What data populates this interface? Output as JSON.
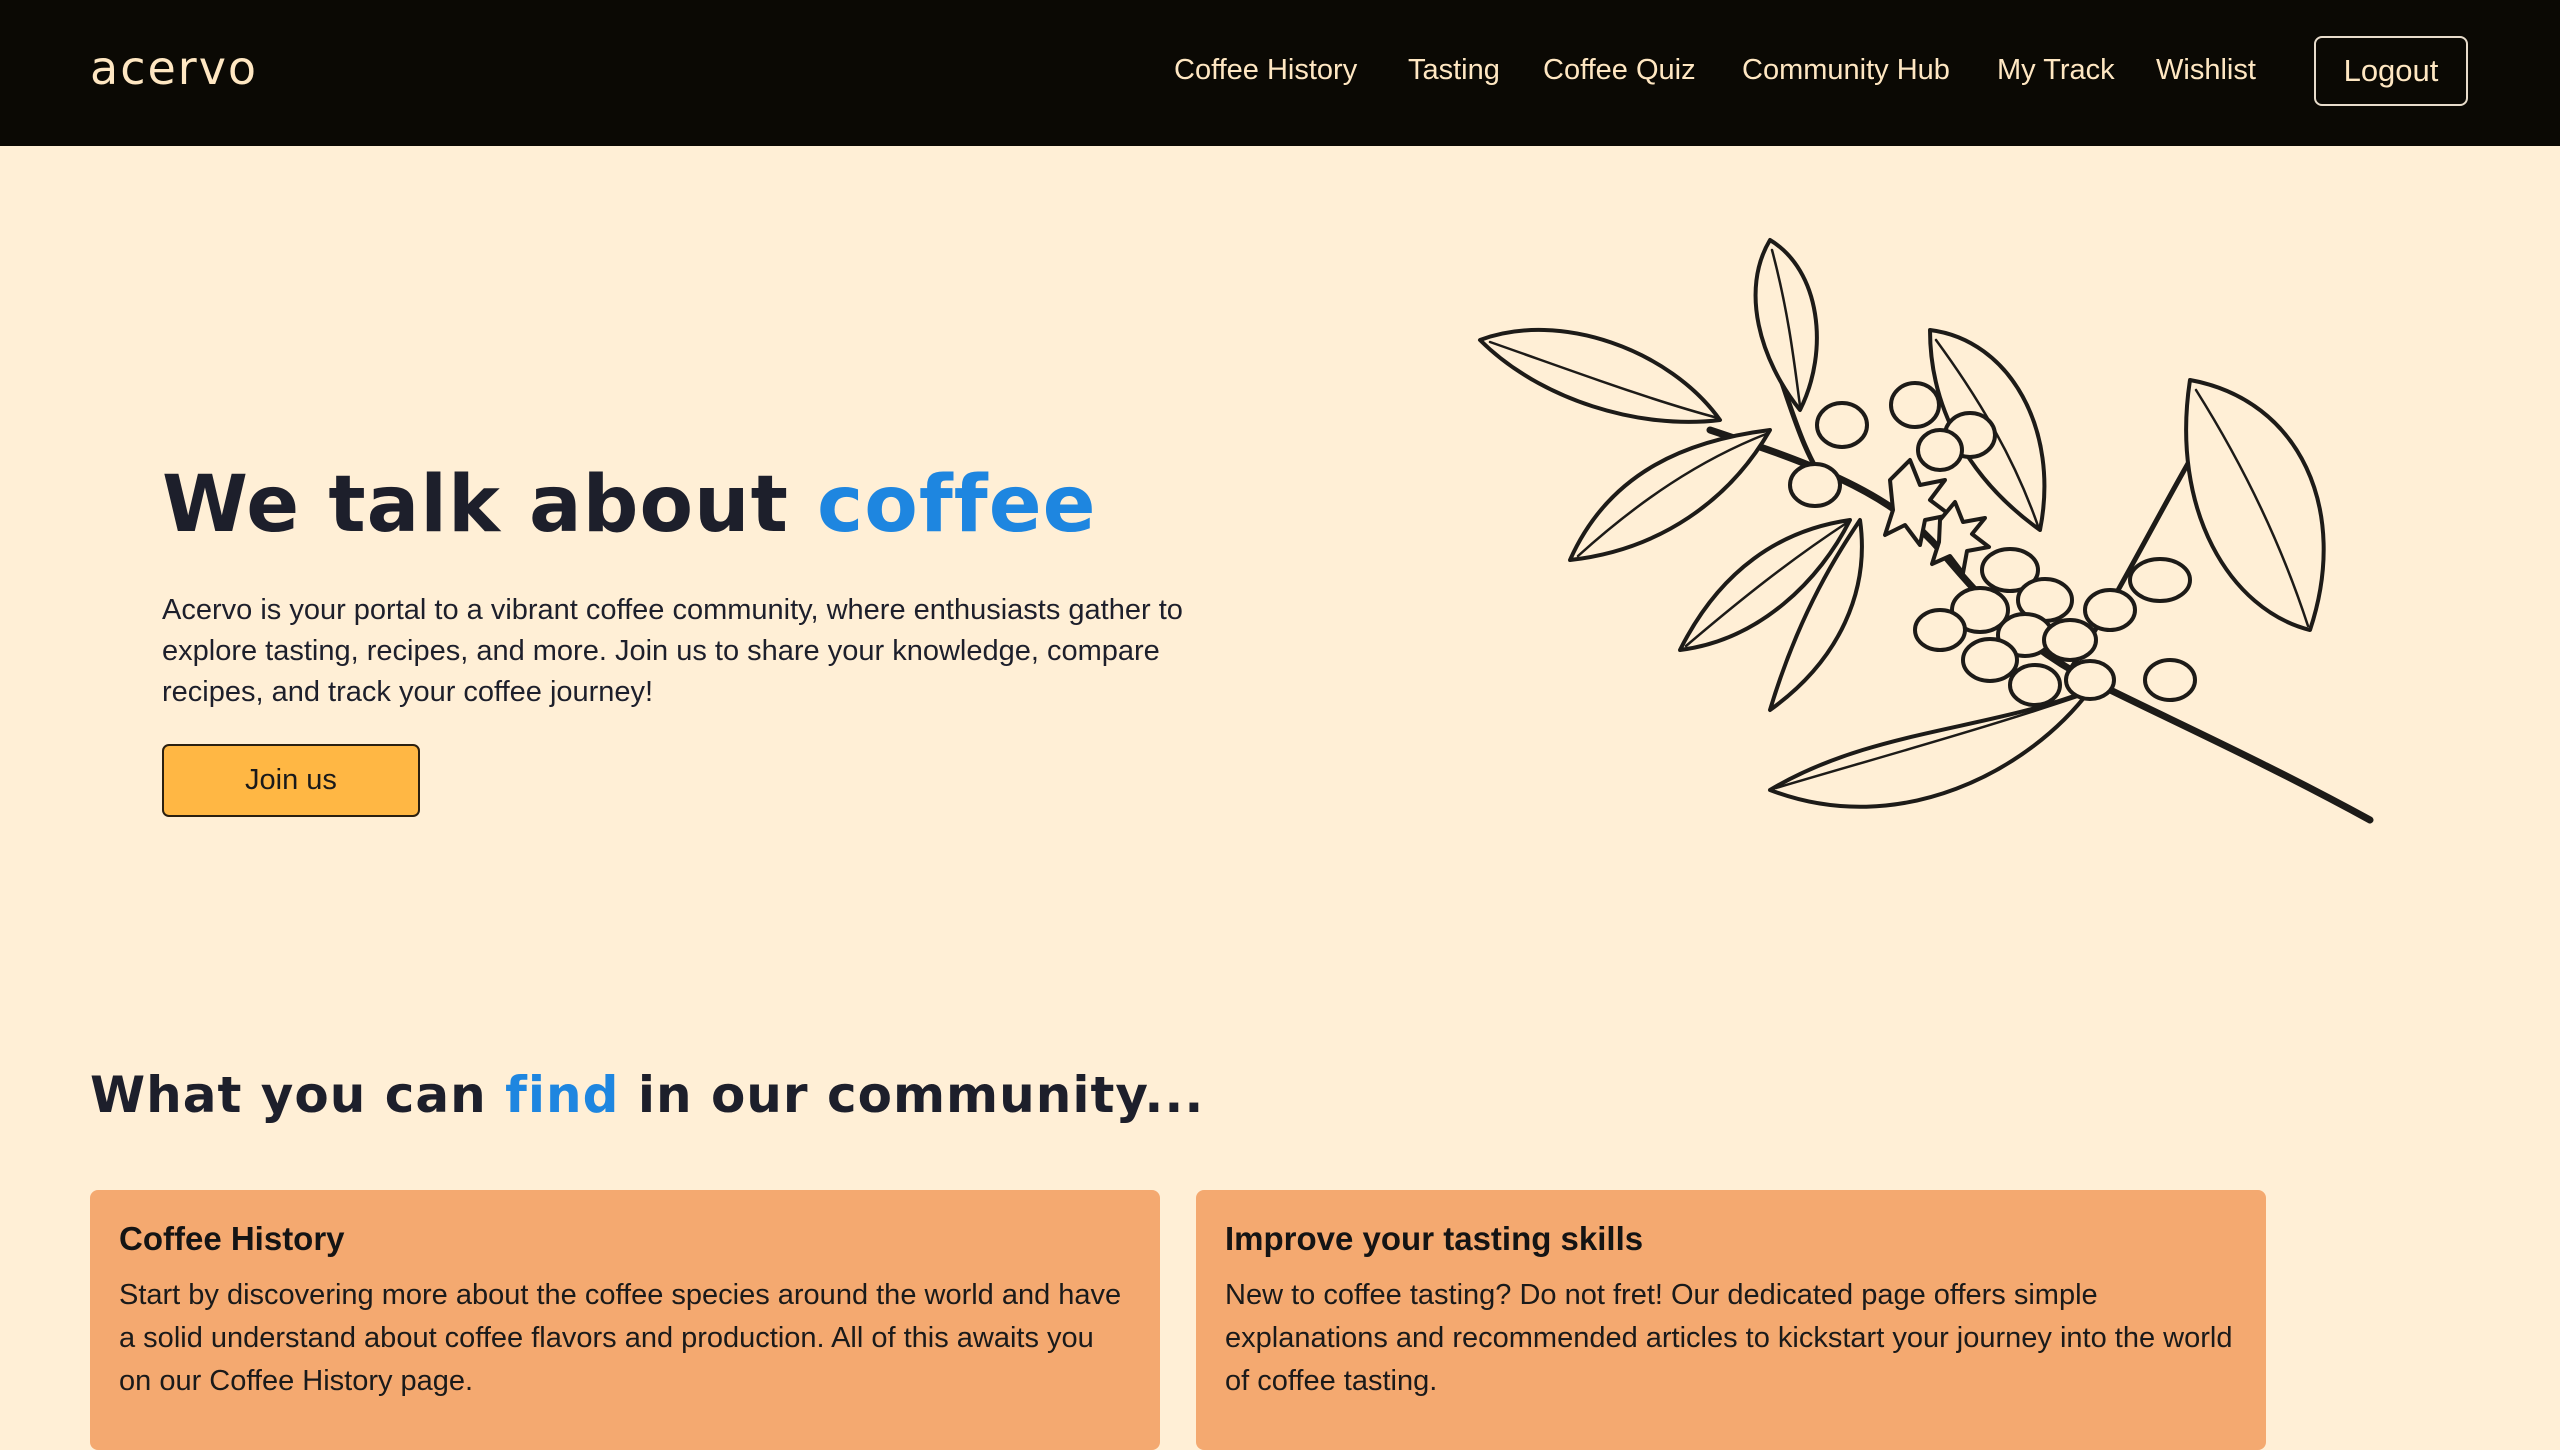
{
  "header": {
    "logo": "acervo",
    "nav": [
      "Coffee History",
      "Tasting",
      "Coffee Quiz",
      "Community Hub",
      "My Track",
      "Wishlist"
    ],
    "logout_label": "Logout"
  },
  "hero": {
    "title_prefix": "We talk about ",
    "title_accent": "coffee",
    "description": "Acervo is your portal to a vibrant coffee community, where enthusiasts gather to explore tasting, recipes, and more. Join us to share your knowledge, compare recipes, and track your coffee journey!",
    "cta_label": "Join us"
  },
  "community": {
    "title_prefix": "What you can ",
    "title_accent": "find",
    "title_suffix": " in our community...",
    "cards": [
      {
        "title": "Coffee History",
        "text": "Start by discovering more about the coffee species around the world and have a solid understand about coffee flavors and production. All of this awaits you on our Coffee History page."
      },
      {
        "title": "Improve your tasting skills",
        "text": "New to coffee tasting? Do not fret! Our dedicated page offers simple explanations and recommended articles to kickstart your journey into the world of coffee tasting."
      }
    ]
  },
  "colors": {
    "background": "#ffefd6",
    "header": "#0b0904",
    "accent": "#1e86e0",
    "button": "#ffb744",
    "card": "#f4a970"
  }
}
